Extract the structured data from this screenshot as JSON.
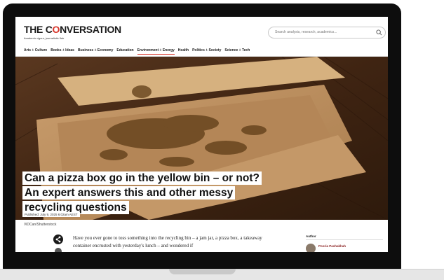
{
  "site": {
    "logo_prefix": "THE C",
    "logo_o": "O",
    "logo_suffix": "NVERSATION",
    "tagline": "Academic rigour, journalistic flair"
  },
  "search": {
    "placeholder": "Search analysis, research, academics..."
  },
  "nav": {
    "items": [
      "Arts + Culture",
      "Books + Ideas",
      "Business + Economy",
      "Education",
      "Environment + Energy",
      "Health",
      "Politics + Society",
      "Science + Tech"
    ],
    "active": "Environment + Energy"
  },
  "article": {
    "headline_lines": [
      "Can a pizza box go in the yellow bin – or not?",
      "An expert answers this and other messy",
      "recycling questions"
    ],
    "published": "Published: July 9, 2025 6:02am AEST",
    "image_credit": "ViDCan/Shutterstock",
    "body": "Have you ever gone to toss something into the recycling bin – a jam jar, a pizza box, a takeaway container encrusted with yesterday's lunch – and wondered if"
  },
  "sidebar": {
    "author_heading": "Author",
    "author_name": "Pooria Pashakhah"
  },
  "colors": {
    "brand_red": "#d8352a",
    "wood": "#4a2d17",
    "cardboard": "#b98d5f"
  }
}
